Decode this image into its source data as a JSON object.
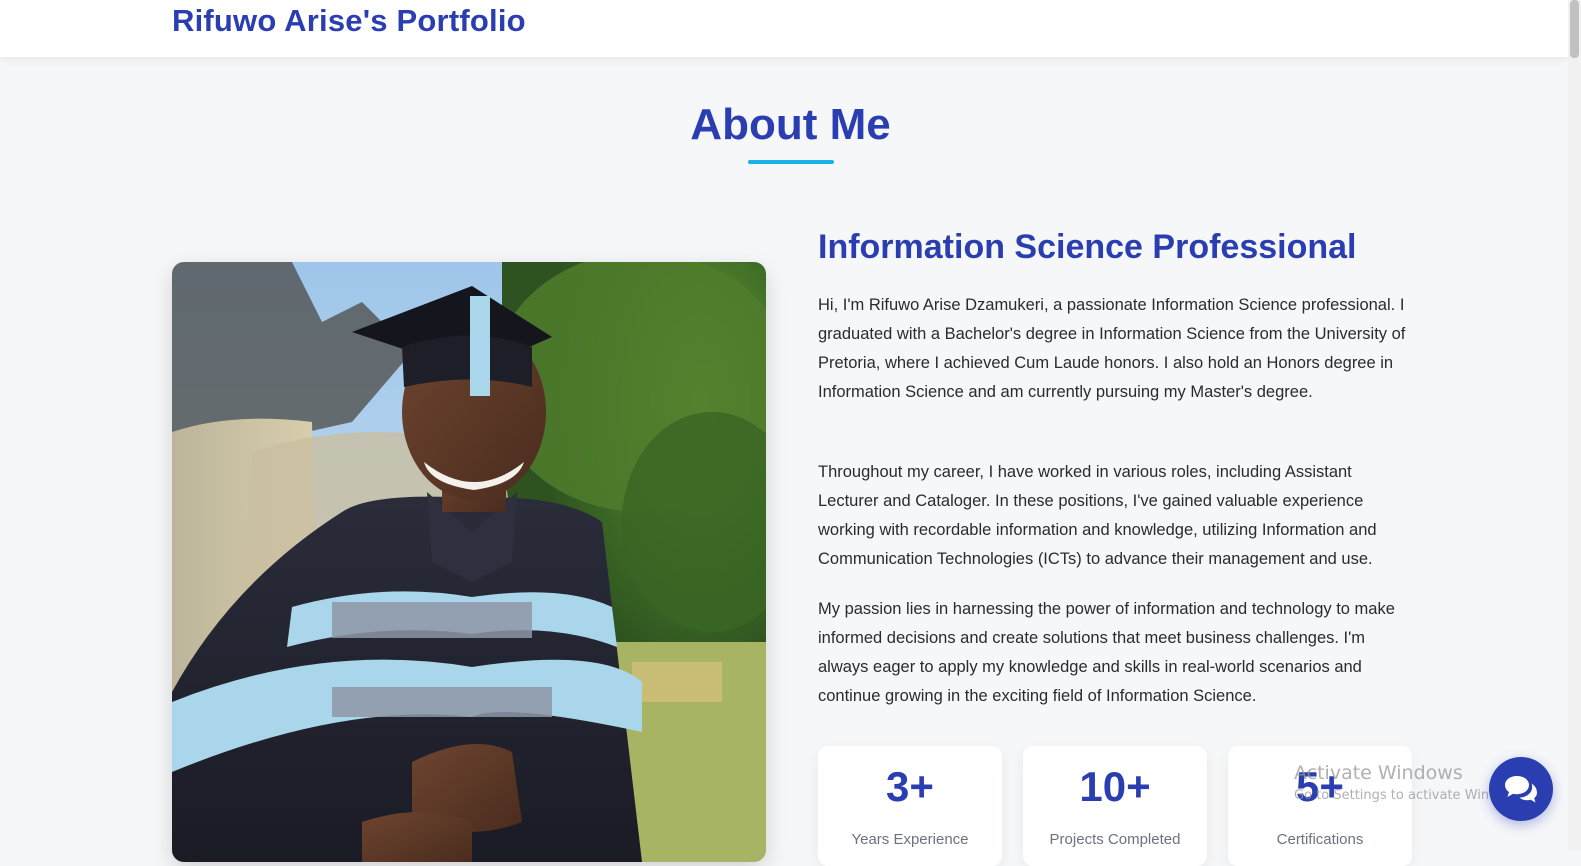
{
  "header": {
    "brand": "Rifuwo Arise's Portfolio"
  },
  "about": {
    "title": "About Me",
    "subheading": "Information Science Professional",
    "paragraphs": [
      "Hi, I'm Rifuwo Arise Dzamukeri, a passionate Information Science professional. I graduated with a Bachelor's degree in Information Science from the University of Pretoria, where I achieved Cum Laude honors. I also hold an Honors degree in Information Science and am currently pursuing my Master's degree.",
      "Throughout my career, I have worked in various roles, including Assistant Lecturer and Cataloger. In these positions, I've gained valuable experience working with recordable information and knowledge, utilizing Information and Communication Technologies (ICTs) to advance their management and use.",
      "My passion lies in harnessing the power of information and technology to make informed decisions and create solutions that meet business challenges. I'm always eager to apply my knowledge and skills in real-world scenarios and continue growing in the exciting field of Information Science."
    ],
    "stats": [
      {
        "value": "3+",
        "label": "Years Experience"
      },
      {
        "value": "10+",
        "label": "Projects Completed"
      },
      {
        "value": "5+",
        "label": "Certifications"
      }
    ]
  },
  "watermark": {
    "title": "Activate Windows",
    "subtitle": "Go to Settings to activate Windows."
  },
  "chat": {
    "icon": "chat-bubbles-icon"
  },
  "colors": {
    "primary": "#2a3eb1",
    "accent": "#1ab0e8",
    "background": "#f6f7f9"
  }
}
